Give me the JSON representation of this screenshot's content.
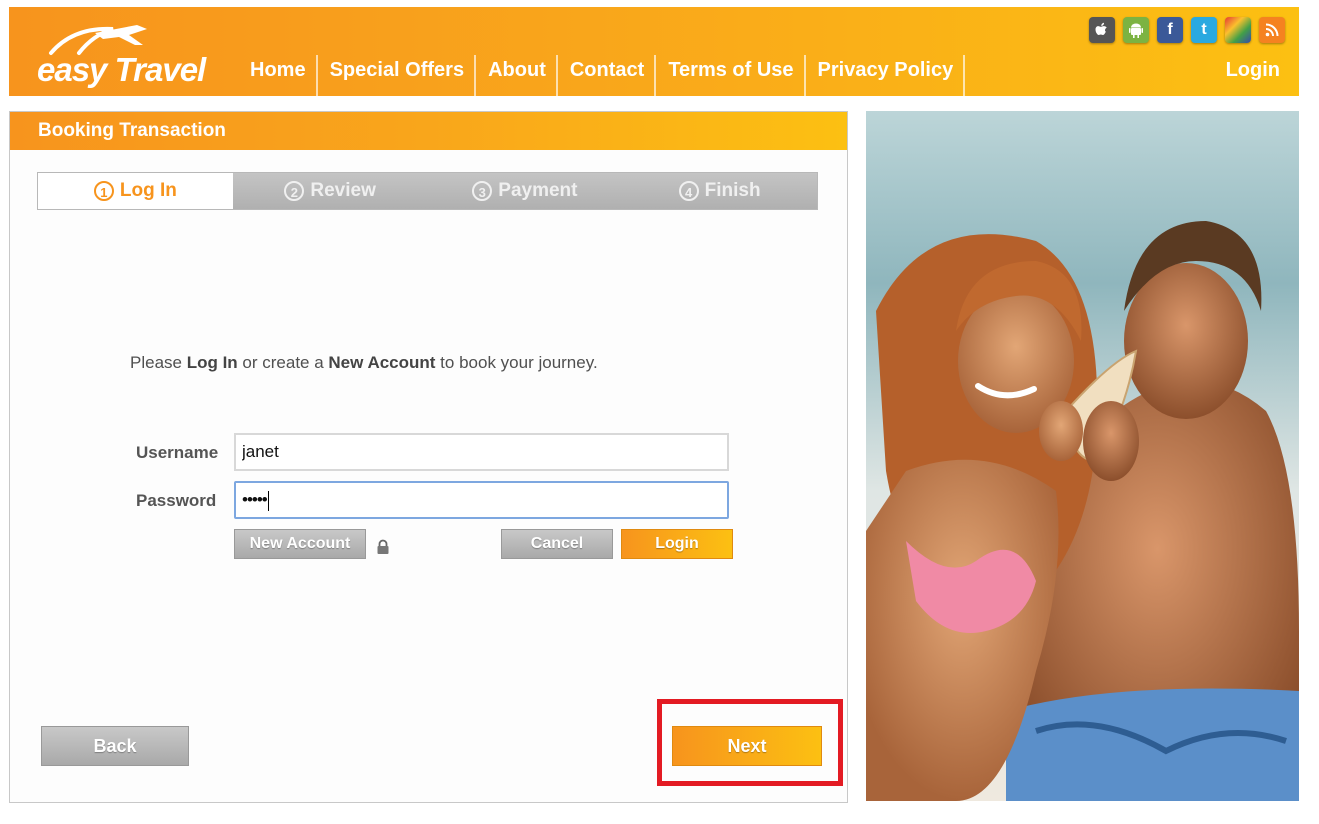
{
  "header": {
    "logo_text_a": "easy",
    "logo_text_b": "Travel",
    "nav": [
      "Home",
      "Special Offers",
      "About",
      "Contact",
      "Terms of Use",
      "Privacy Policy"
    ],
    "login": "Login",
    "social": [
      {
        "name": "apple-icon",
        "glyph": "",
        "color": "#4a4a4a"
      },
      {
        "name": "android-icon",
        "glyph": "",
        "color": "#7cb342"
      },
      {
        "name": "facebook-icon",
        "glyph": "f",
        "color": "#3b5998"
      },
      {
        "name": "twitter-icon",
        "glyph": "t",
        "color": "#1da1f2"
      },
      {
        "name": "puzzle-icon",
        "glyph": "",
        "color": "#6d3fa8"
      },
      {
        "name": "rss-icon",
        "glyph": "",
        "color": "#f58220"
      }
    ]
  },
  "booking": {
    "title": "Booking Transaction",
    "steps": [
      {
        "num": "1",
        "label": "Log In",
        "active": true
      },
      {
        "num": "2",
        "label": "Review",
        "active": false
      },
      {
        "num": "3",
        "label": "Payment",
        "active": false
      },
      {
        "num": "4",
        "label": "Finish",
        "active": false
      }
    ],
    "intro_pre": "Please ",
    "intro_b1": "Log In",
    "intro_mid": " or create a ",
    "intro_b2": "New Account",
    "intro_post": " to book your journey.",
    "username_label": "Username",
    "username_value": "janet",
    "password_label": "Password",
    "password_value": "•••••",
    "new_account": "New Account",
    "cancel": "Cancel",
    "login": "Login",
    "back": "Back",
    "next": "Next"
  },
  "colors": {
    "accent": "#f7941d",
    "accent_light": "#fcc012",
    "highlight": "#e31b23"
  }
}
